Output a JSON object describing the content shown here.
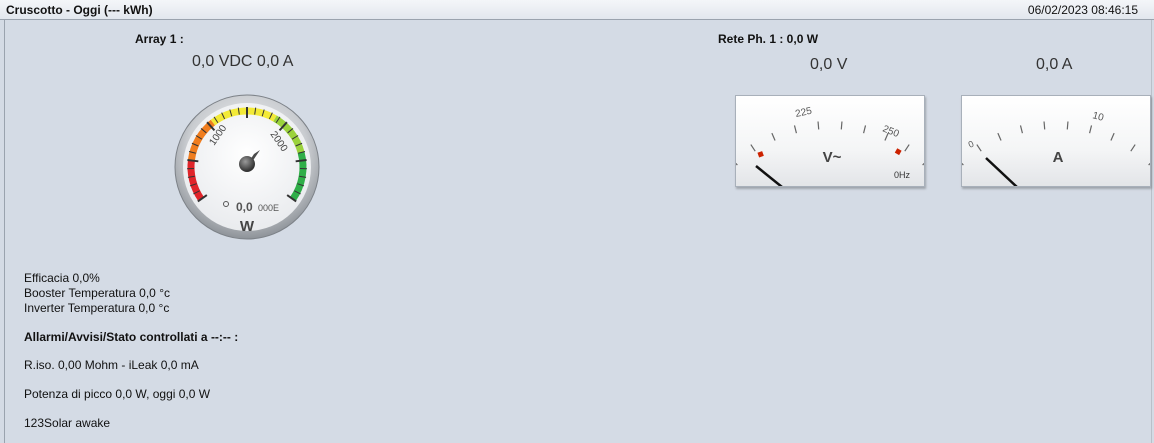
{
  "window": {
    "title": "Cruscotto - Oggi (--- kWh)",
    "datetime": "06/02/2023 08:46:15"
  },
  "array": {
    "label": "Array 1 :",
    "reading": "0,0 VDC 0,0 A",
    "gauge": {
      "unit": "W",
      "value_text": "0,0",
      "ticks": [
        "1000",
        "2000"
      ],
      "odometer": "000E",
      "value": 0,
      "max": 3000
    }
  },
  "grid": {
    "label": "Rete Ph. 1 : 0,0 W",
    "voltage_reading": "0,0 V",
    "current_reading": "0,0 A",
    "volt_meter": {
      "unit": "V~",
      "ticks": [
        "225",
        "250"
      ],
      "freq": "0Hz"
    },
    "amp_meter": {
      "unit": "A",
      "ticks": [
        "0",
        "10"
      ]
    }
  },
  "info": {
    "efficacia": "Efficacia 0,0%",
    "booster_temp": "Booster Temperatura 0,0 °c",
    "inverter_temp": "Inverter Temperatura 0,0 °c"
  },
  "alarms": {
    "heading": "Allarmi/Avvisi/Stato controllati a --:-- :",
    "riso": "R.iso. 0,00 Mohm - iLeak 0,0 mA",
    "peak": "Potenza di picco 0,0 W, oggi 0,0 W",
    "status": "123Solar awake"
  },
  "colors": {
    "background": "#d4dbe5",
    "gauge_red": "#e0242a",
    "gauge_orange": "#f07d1e",
    "gauge_yellow": "#f3ea37",
    "gauge_green": "#2fae48",
    "meter_red": "#cc2200"
  }
}
